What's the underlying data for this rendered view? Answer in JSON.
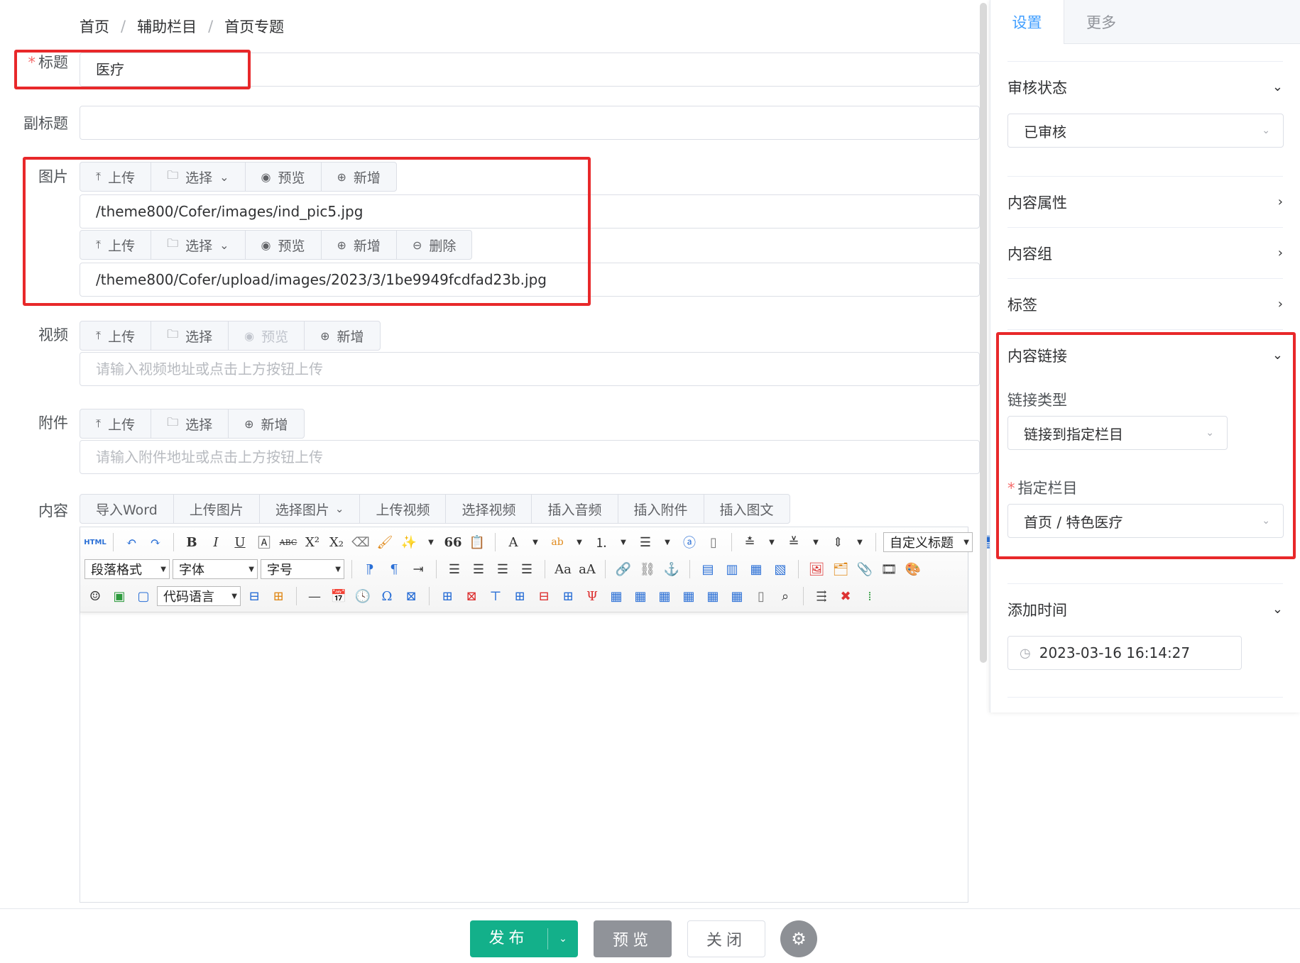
{
  "breadcrumb": [
    "首页",
    "辅助栏目",
    "首页专题"
  ],
  "breadcrumb_sep": "/",
  "form": {
    "title_label": "标题",
    "title_value": "医疗",
    "subtitle_label": "副标题",
    "subtitle_value": "",
    "image_label": "图片",
    "image_rows": [
      {
        "buttons": [
          "上传",
          "选择",
          "预览",
          "新增"
        ],
        "value": "/theme800/Cofer/images/ind_pic5.jpg"
      },
      {
        "buttons": [
          "上传",
          "选择",
          "预览",
          "新增",
          "删除"
        ],
        "value": "/theme800/Cofer/upload/images/2023/3/1be9949fcdfad23b.jpg"
      }
    ],
    "video_label": "视频",
    "video_buttons": [
      "上传",
      "选择",
      "预览",
      "新增"
    ],
    "video_placeholder": "请输入视频地址或点击上方按钮上传",
    "attach_label": "附件",
    "attach_buttons": [
      "上传",
      "选择",
      "新增"
    ],
    "attach_placeholder": "请输入附件地址或点击上方按钮上传",
    "content_label": "内容",
    "editor_buttons": [
      "导入Word",
      "上传图片",
      "选择图片",
      "上传视频",
      "选择视频",
      "插入音频",
      "插入附件",
      "插入图文"
    ],
    "editor_selects": {
      "custom_title": "自定义标题",
      "paragraph": "段落格式",
      "font": "字体",
      "size": "字号",
      "code": "代码语言"
    },
    "editor_icons": {
      "html": "HTML",
      "bold": "B",
      "italic": "I",
      "underline": "U",
      "strike": "ABC",
      "quote": "66"
    }
  },
  "right": {
    "tabs": [
      "设置",
      "更多"
    ],
    "audit_label": "审核状态",
    "audit_value": "已审核",
    "content_attr": "内容属性",
    "content_group": "内容组",
    "tags": "标签",
    "content_link": "内容链接",
    "link_type_label": "链接类型",
    "link_type_value": "链接到指定栏目",
    "target_label": "指定栏目",
    "target_value": "首页 / 特色医疗",
    "add_time_label": "添加时间",
    "add_time_value": "2023-03-16 16:14:27"
  },
  "bottom": {
    "publish": "发布",
    "preview": "预览",
    "close": "关闭"
  },
  "colors": {
    "accent": "#409eff",
    "publish": "#13b08a",
    "highlight": "#e8282a",
    "required": "#f56c6c"
  }
}
